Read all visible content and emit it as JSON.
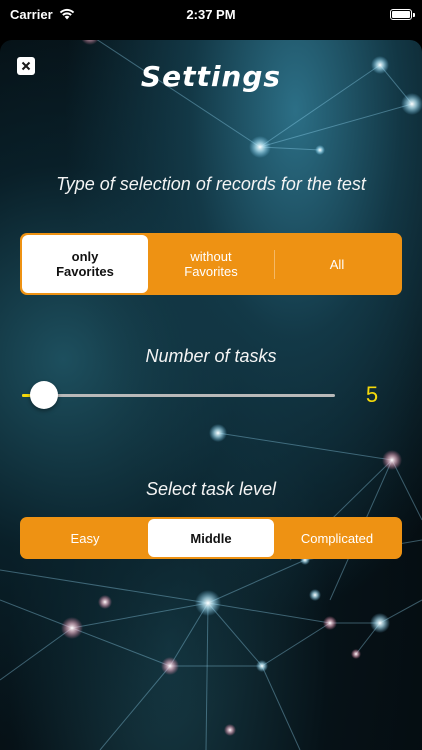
{
  "status": {
    "carrier": "Carrier",
    "time": "2:37 PM"
  },
  "header": {
    "title": "Settings"
  },
  "selection": {
    "label": "Type of selection of records for the test",
    "options": [
      {
        "line1": "only",
        "line2": "Favorites",
        "selected": true
      },
      {
        "line1": "without",
        "line2": "Favorites",
        "selected": false
      },
      {
        "line1": "All",
        "line2": "",
        "selected": false
      }
    ]
  },
  "tasks": {
    "label": "Number of tasks",
    "value": "5",
    "slider_level": 0.04
  },
  "level": {
    "label": "Select task level",
    "options": [
      {
        "label": "Easy",
        "selected": false
      },
      {
        "label": "Middle",
        "selected": true
      },
      {
        "label": "Complicated",
        "selected": false
      }
    ]
  },
  "colors": {
    "accent": "#ee9213",
    "slider": "#f5d90a"
  },
  "icons": {
    "close": "close-icon",
    "wifi": "wifi-icon",
    "battery": "battery-icon"
  }
}
